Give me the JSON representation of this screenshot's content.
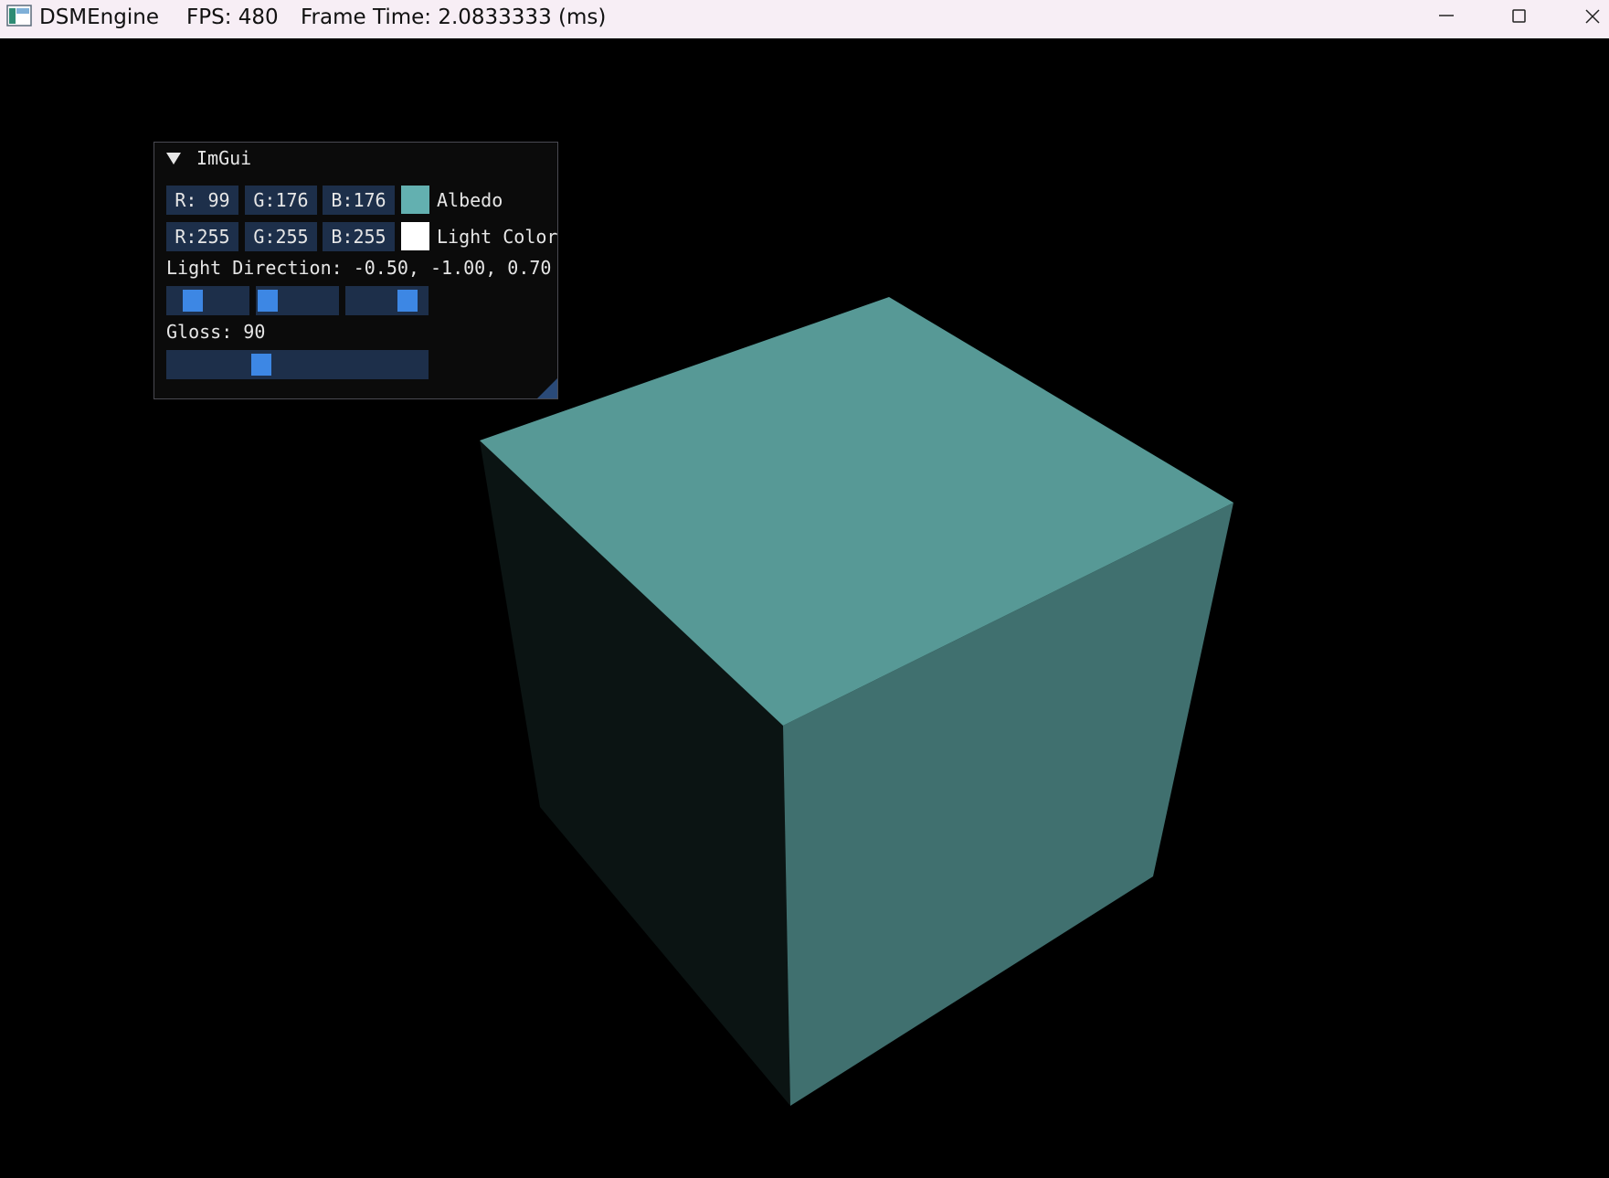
{
  "window": {
    "app_name": "DSMEngine",
    "fps_text": "FPS: 480",
    "frame_time_text": "Frame Time: 2.0833333 (ms)",
    "app_icon": "app-icon",
    "controls": [
      "minimize-icon",
      "maximize-icon",
      "close-icon"
    ]
  },
  "imgui": {
    "title": "ImGui",
    "albedo": {
      "r": "R: 99",
      "g": "G:176",
      "b": "B:176",
      "label": "Albedo",
      "swatch_color": "#63b0b0"
    },
    "light_color": {
      "r": "R:255",
      "g": "G:255",
      "b": "B:255",
      "label": "Light Color",
      "swatch_color": "#ffffff"
    },
    "light_direction": {
      "label": "Light Direction: -0.50, -1.00, 0.70",
      "values": [
        -0.5,
        -1.0,
        0.7
      ],
      "range": [
        -1,
        1
      ]
    },
    "gloss": {
      "label": "Gloss: 90",
      "value": 90,
      "range": [
        1,
        256
      ]
    }
  },
  "scene": {
    "object": "cube",
    "face_colors": {
      "top": "#579996",
      "right": "#40706f",
      "left": "#0b1413"
    }
  }
}
